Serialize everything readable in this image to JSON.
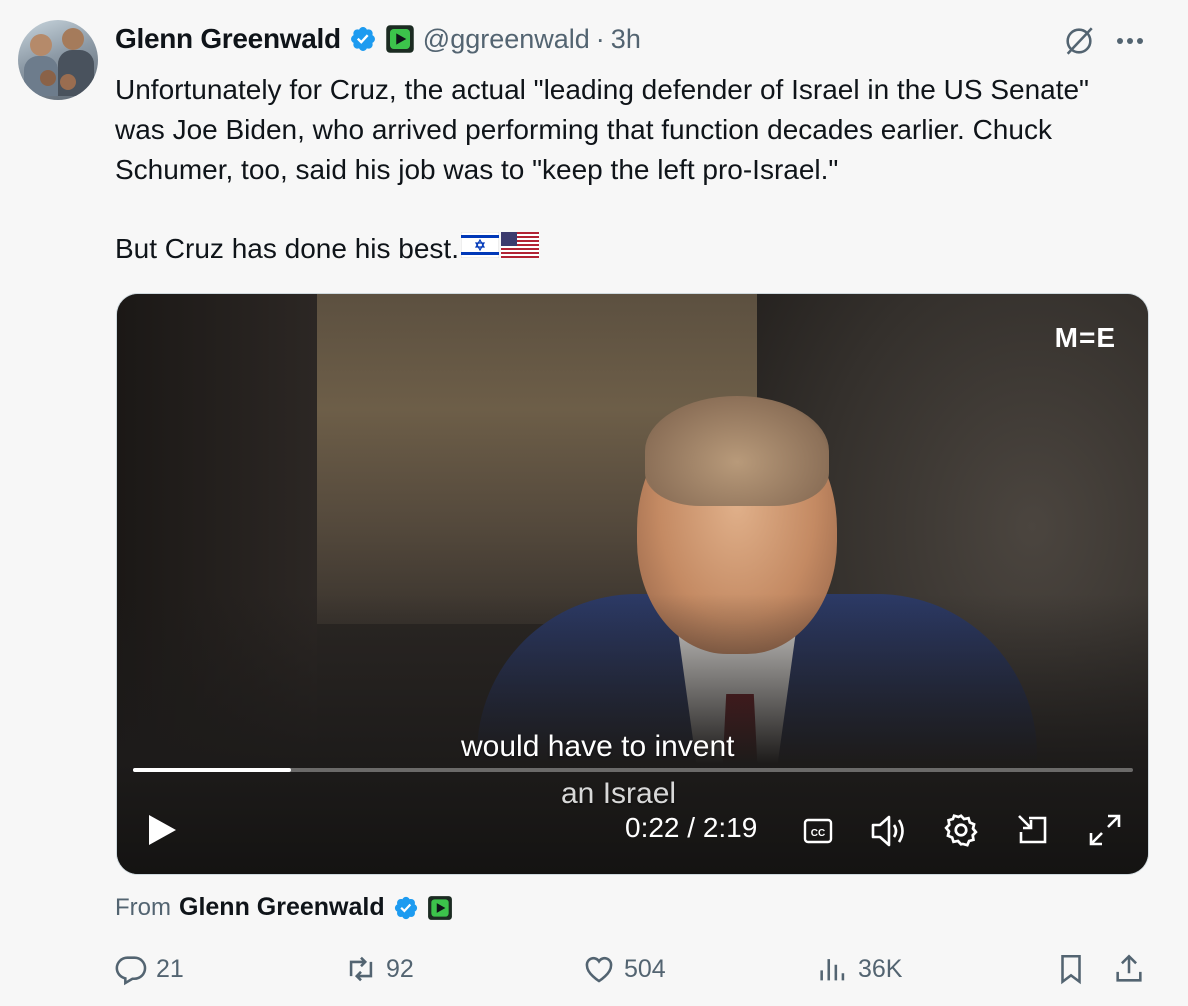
{
  "tweet": {
    "author_name": "Glenn Greenwald",
    "handle": "@ggreenwald",
    "separator": "·",
    "time": "3h",
    "text": "Unfortunately for Cruz, the actual \"leading defender of Israel in the US Senate\" was Joe Biden, who arrived performing that function decades earlier. Chuck Schumer, too, said his job was to \"keep the left pro-Israel.\"",
    "text2": "But Cruz has done his best.",
    "flags": [
      "🇮🇱",
      "🇺🇸"
    ]
  },
  "video": {
    "watermark": "M=E",
    "subtitle_line1": "would have to invent",
    "subtitle_line2": "an Israel",
    "timecode": "0:22 / 2:19",
    "progress_fraction": 0.158
  },
  "from": {
    "label": "From",
    "name": "Glenn Greenwald"
  },
  "actions": {
    "replies": "21",
    "reposts": "92",
    "likes": "504",
    "views": "36K"
  },
  "colors": {
    "verified_blue": "#1d9bf0",
    "secondary_text": "#536471",
    "affiliate_green": "#3cc34b"
  },
  "icons": [
    "reply-icon",
    "repost-icon",
    "like-icon",
    "views-icon",
    "bookmark-icon",
    "share-icon",
    "grok-icon",
    "more-icon",
    "play-icon",
    "captions-icon",
    "volume-icon",
    "settings-icon",
    "pip-icon",
    "fullscreen-icon",
    "verified-badge-icon",
    "affiliate-badge-icon"
  ]
}
